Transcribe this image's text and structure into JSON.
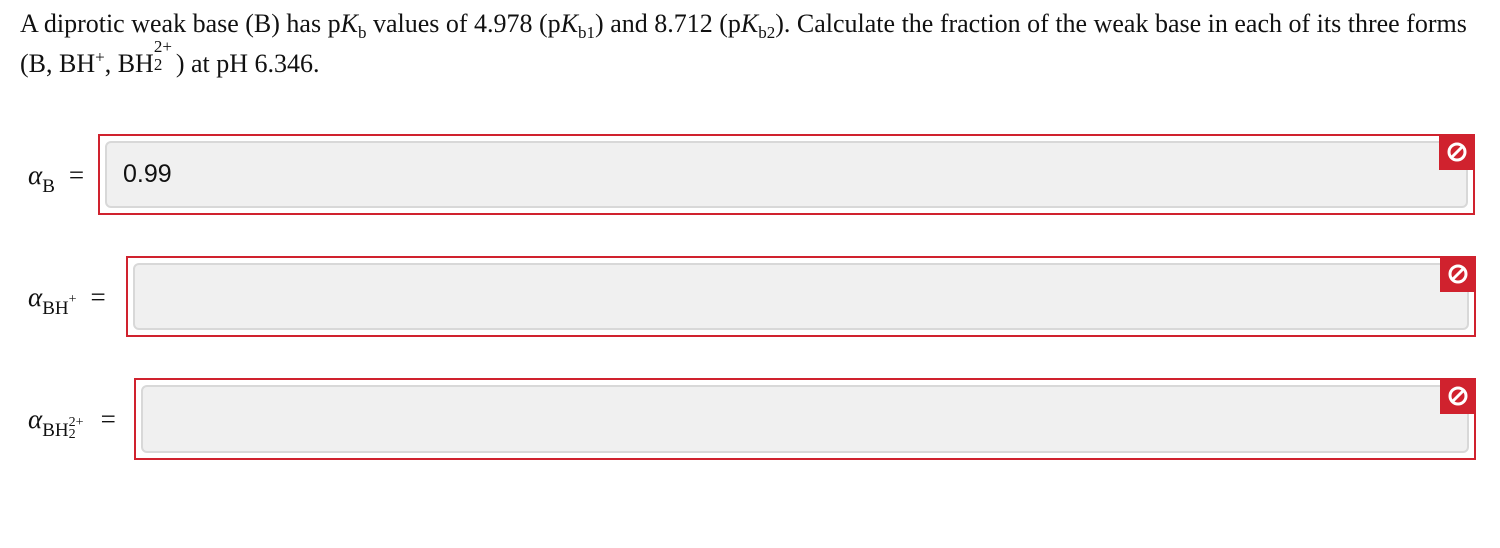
{
  "question": {
    "prefix": "A diprotic weak base (B) has p",
    "Kb": "K",
    "b_sub": "b",
    "mid1": " values of 4.978 (p",
    "K1": "K",
    "b1_sub": "b1",
    "mid2": ") and 8.712 (p",
    "K2": "K",
    "b2_sub": "b2",
    "mid3": "). Calculate the fraction of the weak base in each of its three forms (B, BH",
    "plus": "+",
    "mid4": ", BH",
    "two_plus": "2+",
    "two": "2",
    "suffix": ") at pH 6.346."
  },
  "answers": [
    {
      "alpha": "α",
      "species": "B",
      "charge": "",
      "equals": "=",
      "value": "0.99",
      "status_icon": "blocked-icon",
      "status_color": "#d0222e"
    },
    {
      "alpha": "α",
      "species": "BH",
      "charge": "+",
      "equals": "=",
      "value": "",
      "status_icon": "blocked-icon",
      "status_color": "#d0222e"
    },
    {
      "alpha": "α",
      "species": "BH",
      "species_sub": "2",
      "charge": "2+",
      "equals": "=",
      "value": "",
      "status_icon": "blocked-icon",
      "status_color": "#d0222e"
    }
  ]
}
